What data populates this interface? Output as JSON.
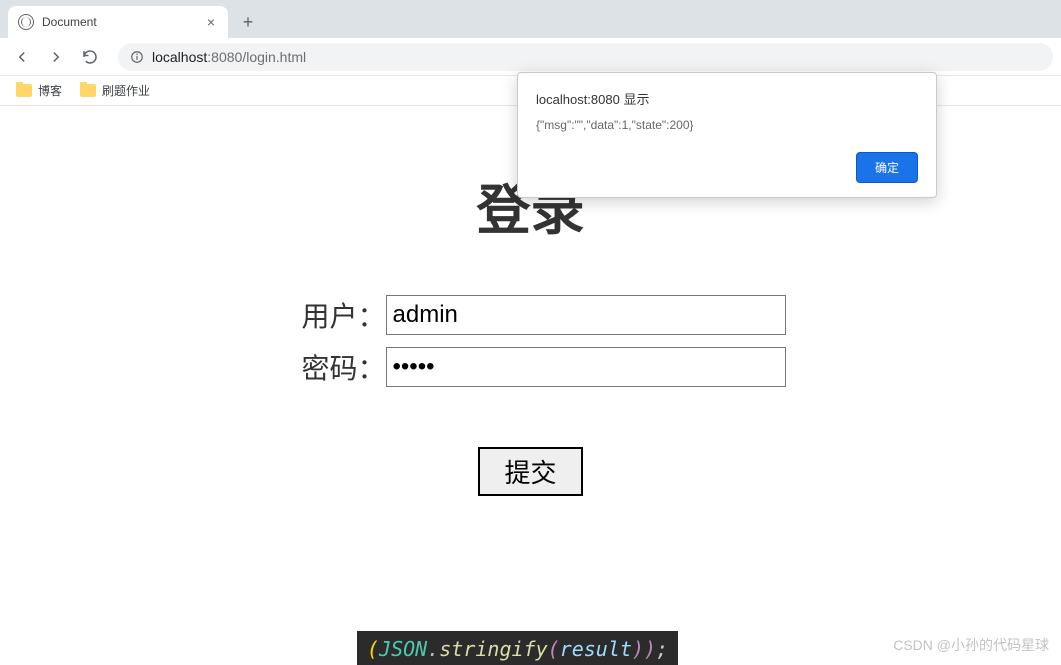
{
  "tab": {
    "title": "Document"
  },
  "omnibox": {
    "host": "localhost",
    "port": ":8080",
    "path": "/login.html"
  },
  "bookmarks": [
    {
      "label": "博客"
    },
    {
      "label": "刷题作业"
    }
  ],
  "login": {
    "title": "登录",
    "user_label": "用户：",
    "password_label": "密码：",
    "user_value": "admin",
    "password_value": "•••••",
    "submit_label": "提交"
  },
  "alert": {
    "title": "localhost:8080 显示",
    "body": "{\"msg\":\"\",\"data\":1,\"state\":200}",
    "ok_label": "确定"
  },
  "code": {
    "paren_open": "(",
    "json": "JSON",
    "dot": ".",
    "stringify": "stringify",
    "paren_open2": "(",
    "result": "result",
    "paren_close": "))",
    "semi": ";"
  },
  "watermark": "CSDN @小孙的代码星球"
}
